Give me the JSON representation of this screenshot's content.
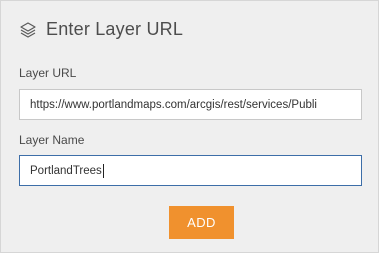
{
  "header": {
    "icon": "layers-icon",
    "title": "Enter Layer URL"
  },
  "form": {
    "url_label": "Layer URL",
    "url_value": "https://www.portlandmaps.com/arcgis/rest/services/Publi",
    "name_label": "Layer Name",
    "name_value": "PortlandTrees",
    "add_button": "ADD"
  },
  "colors": {
    "panel_bg": "#efefef",
    "button_bg": "#f0912e",
    "active_border": "#3d6ea8"
  }
}
